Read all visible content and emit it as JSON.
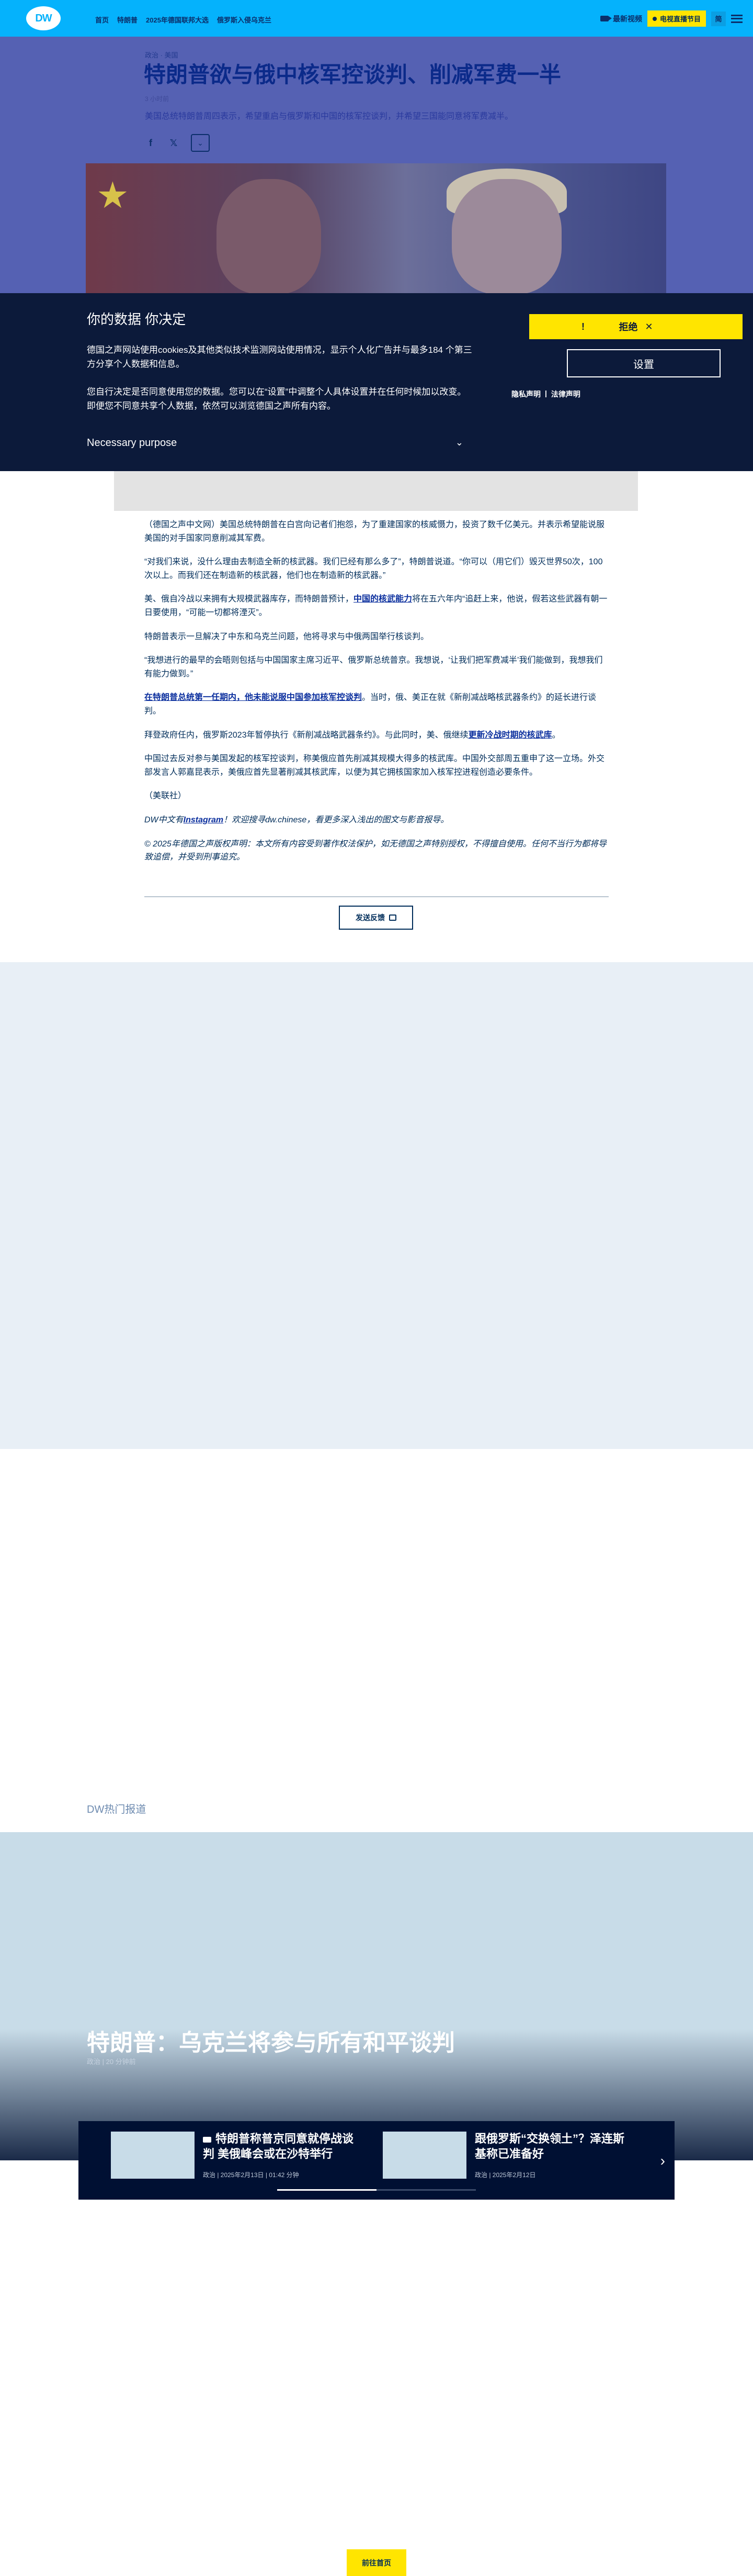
{
  "nav": {
    "logo": "DW",
    "links": [
      "首页",
      "特朗普",
      "2025年德国联邦大选",
      "俄罗斯入侵乌克兰"
    ],
    "video_label": "最新视频",
    "live_label": "电视直播节目",
    "lang_label": "简"
  },
  "article": {
    "breadcrumb": "政治 · 美国",
    "title": "特朗普欲与俄中核军控谈判、削减军费一半",
    "date": "3 小时前",
    "teaser": "美国总统特朗普周四表示，希望重启与俄罗斯和中国的核军控谈判，并希望三国能同意将军费减半。",
    "paragraphs": [
      "（德国之声中文网）美国总统特朗普在白宫向记者们抱怨，为了重建国家的核威慑力，投资了数千亿美元。并表示希望能说服美国的对手国家同意削减其军费。",
      "“对我们来说，没什么理由去制造全新的核武器。我们已经有那么多了”，特朗普说道。“你可以（用它们）毁灭世界50次，100次以上。而我们还在制造新的核武器，他们也在制造新的核武器。”",
      "美、俄自冷战以来拥有大规模武器库存，而特朗普预计，",
      "特朗普表示一旦解决了中东和乌克兰问题，他将寻求与中俄两国举行核谈判。",
      "“我想进行的最早的会晤则包括与中国国家主席习近平、俄罗斯总统普京。我想说，‘让我们把军费减半’我们能做到，我想我们有能力做到。”",
      "",
      "拜登政府任内，俄罗斯2023年暂停执行《新削减战略武器条约》。与此同时，美、俄继续",
      "中国过去反对参与美国发起的核军控谈判，称美俄应首先削减其规模大得多的核武库。中国外交部周五重申了这一立场。外交部发言人郭嘉昆表示，美俄应首先显著削减其核武库，以便为其它拥核国家加入核军控进程创造必要条件。",
      "（美联社）"
    ],
    "p3_link": "中国的核武能力",
    "p3_tail": "将在五六年内“追赶上来，他说，假若这些武器有朝一日要使用，“可能一切都将湮灭”。",
    "p6_link": "在特朗普总统第一任期内，他未能说服中国参加核军控谈判",
    "p6_tail": "。当时，俄、美正在就《新削减战略核武器条约》的延长进行谈判。",
    "p7_link": "更新冷战时期的核武库",
    "p7_tail": "。",
    "instagram_prefix": "DW中文有",
    "instagram_link": "Instagram",
    "instagram_suffix": "！欢迎搜寻dw.chinese，看更多深入浅出的图文与影音报导。",
    "copyright": "© 2025年德国之声版权声明：本文所有内容受到著作权法保护，如无德国之声特别授权，不得擅自使用。任何不当行为都将导致追偿，并受到刑事追究。",
    "feedback_label": "发送反馈"
  },
  "consent": {
    "title": "你的数据 你决定",
    "p1": "德国之声网站使用cookies及其他类似技术监测网站使用情况，显示个人化广告并与最多184 个第三方分享个人数据和信息。",
    "p2": "您自行决定是否同意使用您的数据。您可以在“设置”中调整个人具体设置并在任何时候加以改变。即便您不同意共享个人数据，依然可以浏览德国之声所有内容。",
    "purpose": "Necessary purpose",
    "reject_label": "拒绝",
    "settings_label": "设置",
    "privacy_link": "隐私声明",
    "legal_link": "法律声明",
    "separator": "|"
  },
  "trending": {
    "label": "DW热门报道",
    "hero_title": "特朗普：乌克兰将参与所有和平谈判",
    "hero_meta": "政治 | 20 分钟前",
    "cards": [
      {
        "title": "特朗普称普京同意就停战谈判 美俄峰会或在沙特举行",
        "meta": "政治 | 2025年2月13日 | 01:42 分钟"
      },
      {
        "title": "跟俄罗斯“交换领土”？泽连斯基称已准备好",
        "meta": "政治 | 2025年2月12日"
      }
    ],
    "carousel_progress": 0.5
  },
  "footer": {
    "home_label": "前往首页"
  },
  "colors": {
    "dw_blue": "#05b2fc",
    "dw_yellow": "#ffe500",
    "consent_bg": "#0c1a3a",
    "text_dark": "#002d5a"
  }
}
